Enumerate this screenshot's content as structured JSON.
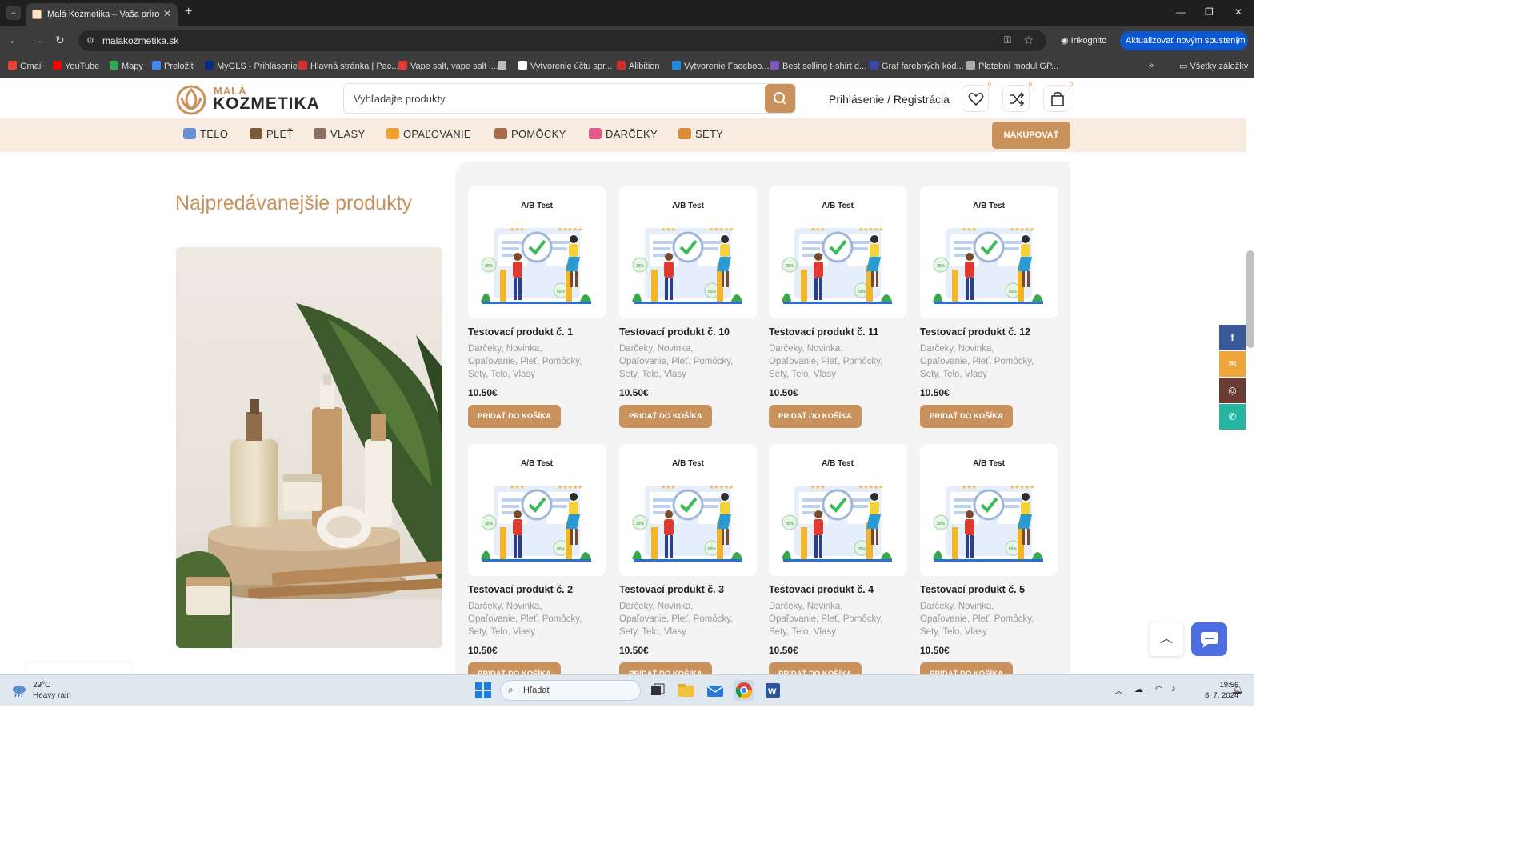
{
  "browser": {
    "tab_title": "Malá Kozmetika – Vaša prírodn",
    "url": "malakozmetika.sk",
    "incognito_label": "Inkognito",
    "update_label": "Aktualizovať novým spustením",
    "bookmarks": [
      {
        "label": "Gmail",
        "color": "#ea4335"
      },
      {
        "label": "YouTube",
        "color": "#ff0000"
      },
      {
        "label": "Mapy",
        "color": "#34a853"
      },
      {
        "label": "Preložiť",
        "color": "#4285f4"
      },
      {
        "label": "MyGLS - Prihlásenie",
        "color": "#0a2a8a"
      },
      {
        "label": "Hlavná stránka | Pac...",
        "color": "#d32f2f"
      },
      {
        "label": "Vape salt, vape salt i...",
        "color": "#e53935"
      },
      {
        "label": "",
        "color": "#bbbbbb"
      },
      {
        "label": "Vytvorenie účtu spr...",
        "color": "#ffffff"
      },
      {
        "label": "Alibition",
        "color": "#d32f2f"
      },
      {
        "label": "Vytvorenie Faceboo...",
        "color": "#1e88e5"
      },
      {
        "label": "Best selling t-shirt d...",
        "color": "#7e57c2"
      },
      {
        "label": "Graf farebných kód...",
        "color": "#3949ab"
      },
      {
        "label": "Platební modul GP...",
        "color": "#aaaaaa"
      }
    ],
    "all_bookmarks_label": "Všetky záložky"
  },
  "site": {
    "logo_small": "MALÁ",
    "logo_big": "KOZMETIKA",
    "search_placeholder": "Vyhľadajte produkty",
    "login_label": "Prihlásenie / Registrácia",
    "wishlist_count": "0",
    "compare_count": "0",
    "cart_count": "0",
    "categories": [
      {
        "label": "TELO",
        "color": "#6d8fd6"
      },
      {
        "label": "PLEŤ",
        "color": "#7b5a3c"
      },
      {
        "label": "VLASY",
        "color": "#8d6e63"
      },
      {
        "label": "OPAĽOVANIE",
        "color": "#f0a030"
      },
      {
        "label": "POMÔCKY",
        "color": "#a66b4a"
      },
      {
        "label": "DARČEKY",
        "color": "#e05a8a"
      },
      {
        "label": "SETY",
        "color": "#d98c3a"
      }
    ],
    "shop_button": "NAKUPOVAŤ",
    "section_title": "Najpredávanejšie produkty",
    "products": [
      {
        "name": "Testovací produkt č. 1",
        "price": "10.50€"
      },
      {
        "name": "Testovací produkt č. 10",
        "price": "10.50€"
      },
      {
        "name": "Testovací produkt č. 11",
        "price": "10.50€"
      },
      {
        "name": "Testovací produkt č. 12",
        "price": "10.50€"
      },
      {
        "name": "Testovací produkt č. 2",
        "price": "10.50€"
      },
      {
        "name": "Testovací produkt č. 3",
        "price": "10.50€"
      },
      {
        "name": "Testovací produkt č. 4",
        "price": "10.50€"
      },
      {
        "name": "Testovací produkt č. 5",
        "price": "10.50€"
      }
    ],
    "product_image_label": "A/B Test",
    "product_categories_line1": "Darčeky, Novinka,",
    "product_categories_line2": "Opaľovanie, Pleť, Pomôcky,",
    "product_categories_line3": "Sety, Telo, Vlasy",
    "add_to_cart_label": "PRIDAŤ DO KOŠÍKA",
    "social": [
      {
        "icon": "facebook-icon",
        "glyph": "f",
        "color": "#3b5998"
      },
      {
        "icon": "email-icon",
        "glyph": "✉",
        "color": "#f0a53a"
      },
      {
        "icon": "instagram-icon",
        "glyph": "◎",
        "color": "#6a3b34"
      },
      {
        "icon": "whatsapp-icon",
        "glyph": "✆",
        "color": "#26b5a0"
      }
    ],
    "accent_color": "#c9915c"
  },
  "taskbar": {
    "temperature": "29°C",
    "weather": "Heavy rain",
    "search_label": "Hľadať",
    "time": "19:56",
    "date": "8. 7. 2024"
  }
}
